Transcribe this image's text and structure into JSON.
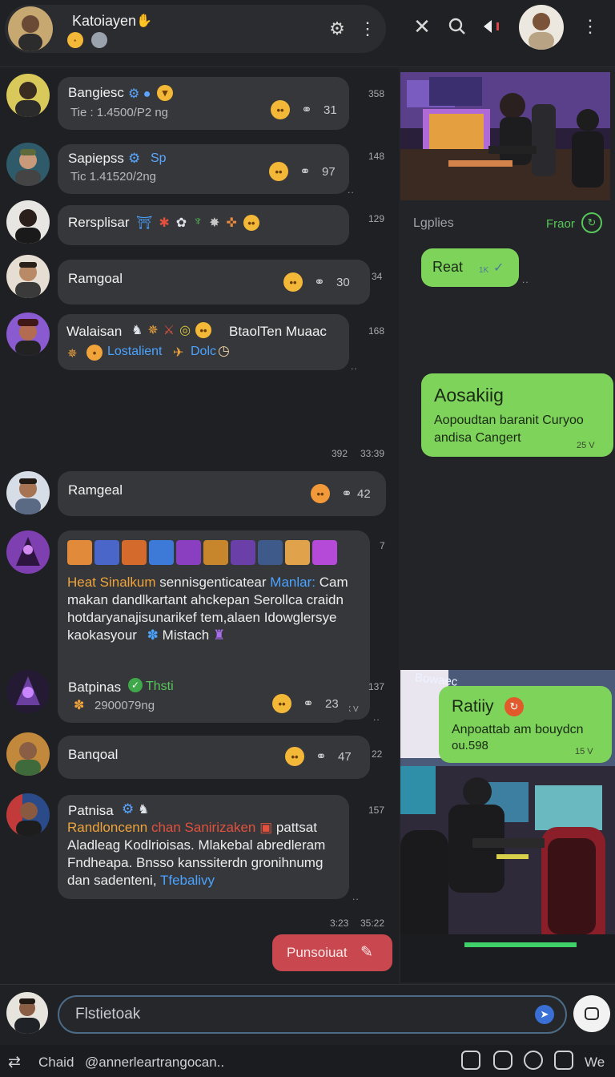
{
  "header": {
    "title": "Katoiayen",
    "icons": [
      "settings-gear-icon",
      "more-icon",
      "close-icon",
      "search-icon",
      "volume-icon",
      "more-vertical-icon"
    ]
  },
  "messages": [
    {
      "name": "Bangiesc",
      "sub": "Tie : 1.4500/P2 ng",
      "count": "31",
      "time": "358"
    },
    {
      "name": "Sapiepss",
      "tag": "Sp",
      "sub": "Tic 1.41520/2ng",
      "count": "97",
      "time": "148"
    },
    {
      "name": "Rersplisar",
      "time": "129"
    },
    {
      "name": "Ramgoal",
      "count": "30",
      "time": "34"
    },
    {
      "name": "Walaisan",
      "name2": "BtaolTen Muaac",
      "line2a": "Lostalient",
      "line2b": "Dolc",
      "time": "168"
    },
    {
      "name": "Ramgeal",
      "count": "42",
      "time_left": "392",
      "time_right": "33:39"
    },
    {
      "line1_orange": "Heat Sinalkum",
      "line1_plain": "sennisgenticatear",
      "line1_blue": "Manlar:",
      "line1_end": "Cam",
      "line2": "makan dandlkartant ahckepan Serollca craidn",
      "line3": "hotdaryanajisunarikef tem,alaen Idowglersye",
      "line4": "kaokasyour",
      "line4_end": "Mistach",
      "time": "7",
      "stamp": "3X V"
    },
    {
      "name": "Batpinas",
      "tag": "Thsti",
      "sub": "2900079ng",
      "count": "23",
      "time": "137"
    },
    {
      "name": "Banqoal",
      "count": "47",
      "time": "22"
    },
    {
      "name": "Patnisa",
      "line1_orange": "Randloncenn",
      "line1_red": "chan Sanirizaken",
      "line1_end": "pattsat",
      "line2": "Aladleag Kodlrioisas. Mlakebal abredleram",
      "line3": "Fndheapa. Bnsso kanssiterdn gronihnumg",
      "line4": "dan sadenteni,",
      "line4_blue": "Tfebalivy",
      "time": "157"
    }
  ],
  "left_stamps": {
    "a": "3:23",
    "b": "35:22"
  },
  "right_panel": {
    "label": "Lgplies",
    "action": "Fraor",
    "bubble1": {
      "text": "Reat",
      "meta": "1K"
    },
    "bubble2": {
      "title": "Aosakiig",
      "line1": "Aopoudtan baranit Curyoo",
      "line2": "andisa Cangert",
      "meta": "25 V"
    },
    "overlay_sign": "Bowaec",
    "bubble3": {
      "title": "Ratiiy",
      "line1": "Anpoattab am bouydcn",
      "line2": "ou.598",
      "meta": "15 V"
    }
  },
  "outgoing": {
    "text": "Punsoiuat"
  },
  "composer": {
    "placeholder": "Flstietoak"
  },
  "bottombar": {
    "left": "Chaid",
    "handle": "@annerleartrangocan..",
    "right": "We"
  },
  "colors": {
    "accent_green": "#7ed35b",
    "bubble_dark": "#36373b",
    "outgoing_red": "#c9474e",
    "link_blue": "#4aa3ff"
  }
}
